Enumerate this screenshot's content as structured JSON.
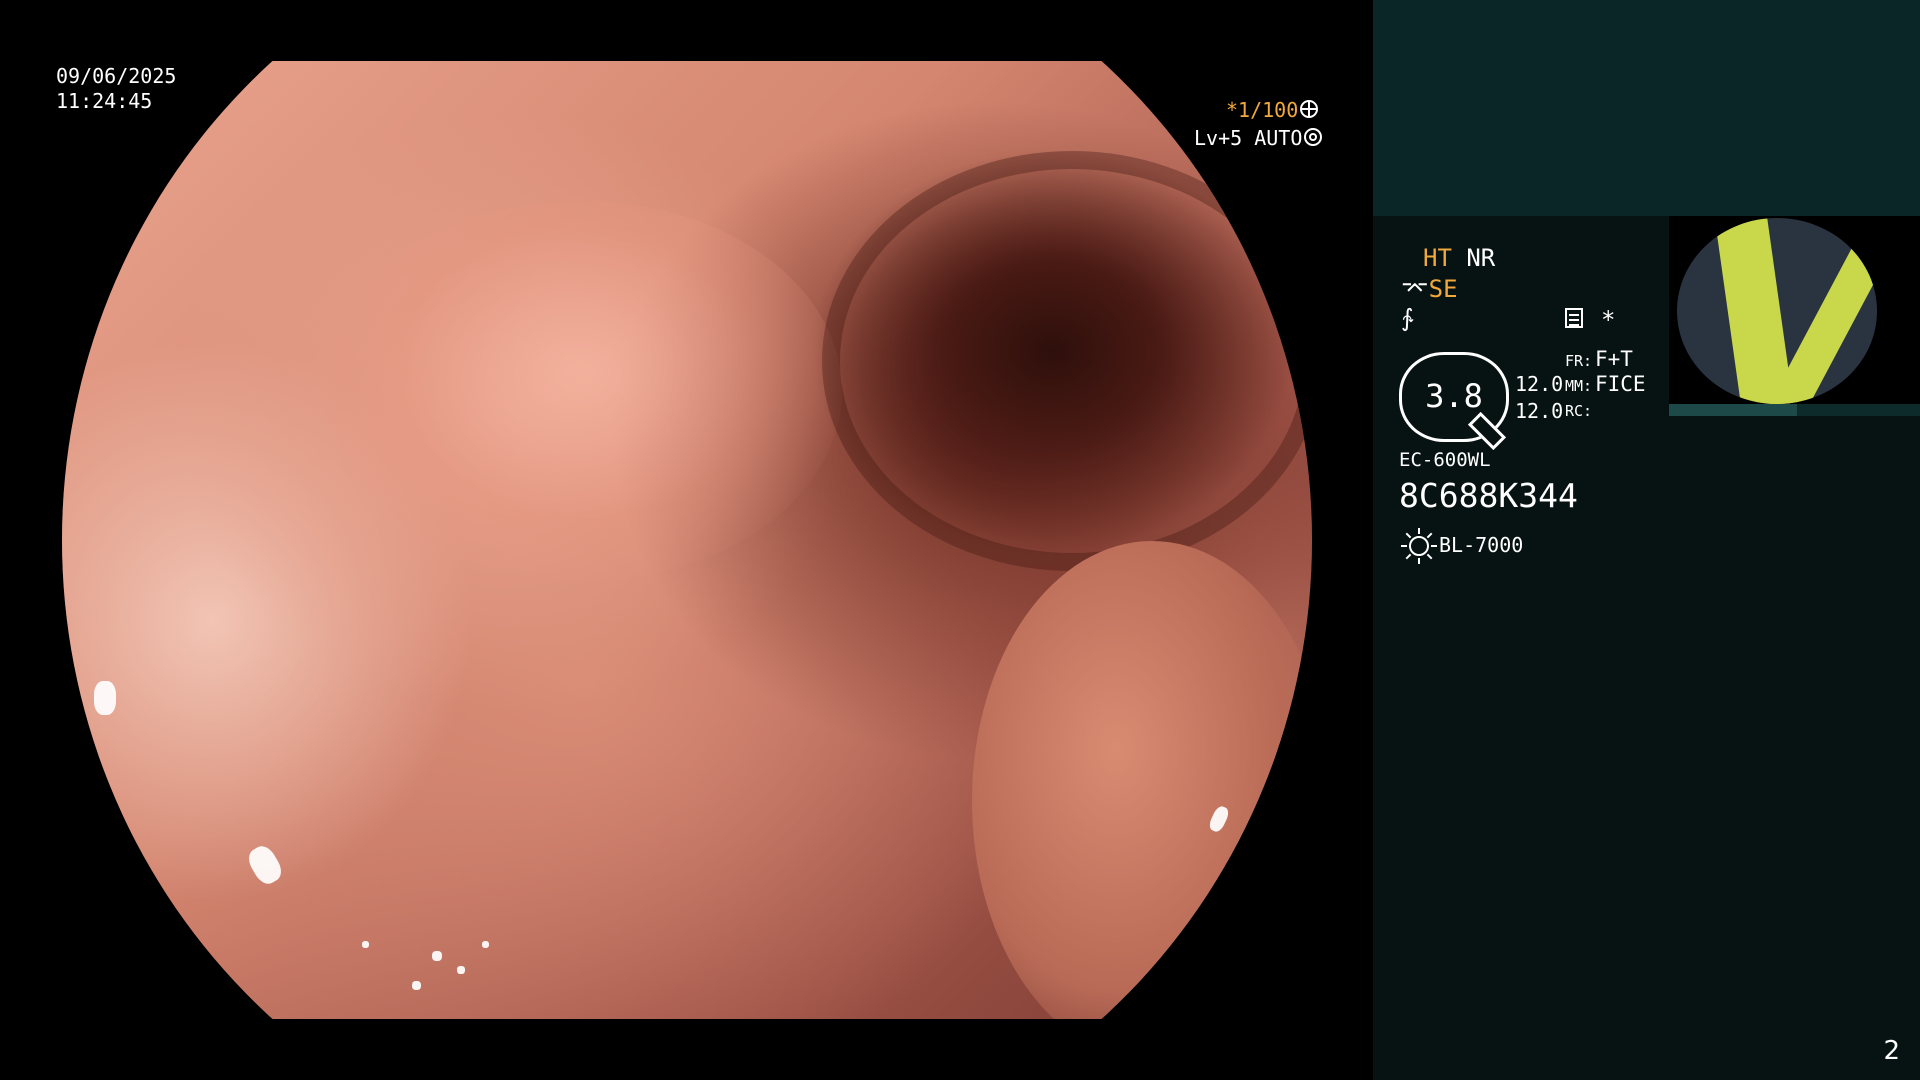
{
  "endoscope_view": {
    "date": "09/06/2025",
    "time": "11:24:45",
    "shutter_speed": "*1/100",
    "level_mode": "Lv+5 AUTO"
  },
  "info_panel": {
    "ht_label": "HT",
    "nr_label": "NR",
    "se_label": "SE",
    "star": "*",
    "zoom_value": "3.8",
    "value_a": "12.0",
    "value_b": "12.0",
    "fr_label": "FR:",
    "fr_value": "F+T",
    "mm_label": "MM:",
    "mm_value": "FICE",
    "rc_label": "RC:",
    "scope_model": "EC-600WL",
    "scope_serial": "8C688K344",
    "light_source": "BL-7000"
  },
  "page_number": "2",
  "colors": {
    "accent_orange": "#f2a93b",
    "panel_bg": "#071312",
    "panel_top_bg": "#0b2626"
  }
}
